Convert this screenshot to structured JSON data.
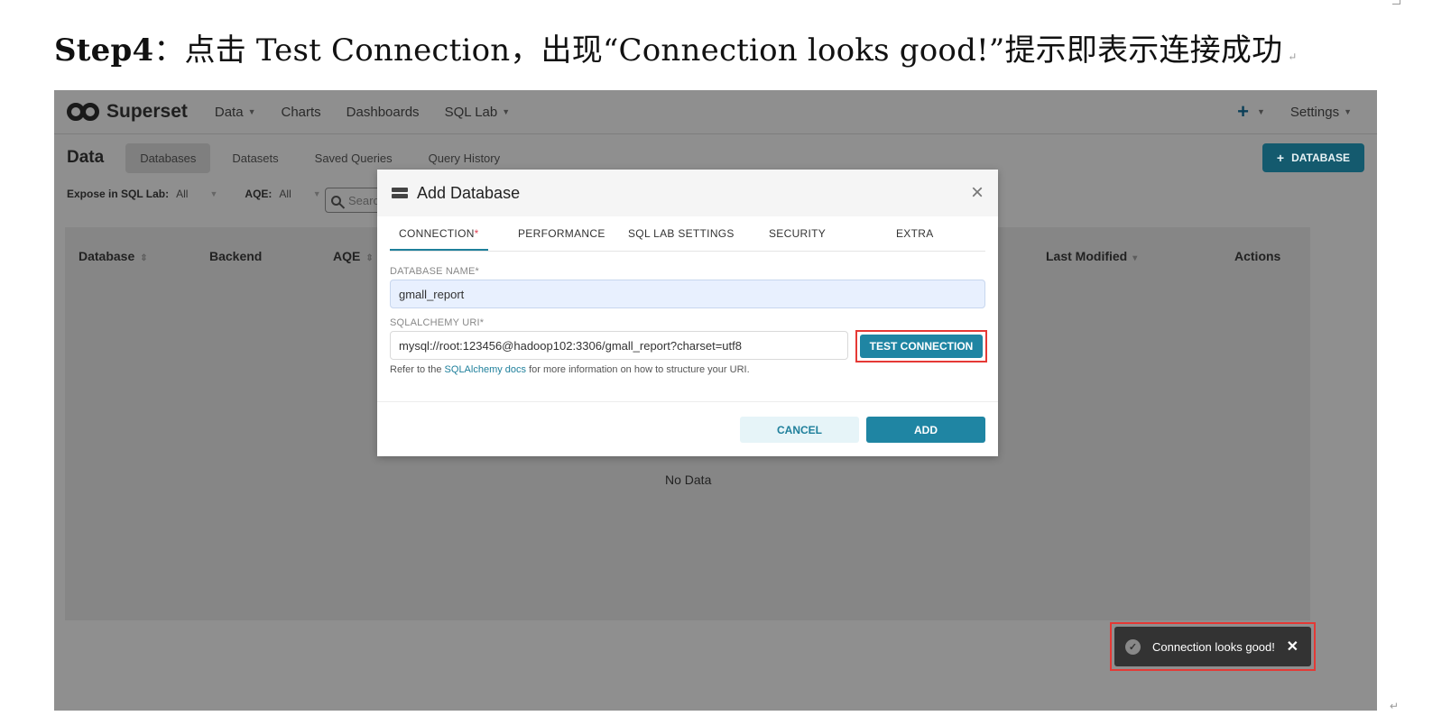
{
  "doc": {
    "step": "Step4",
    "instruction": "：点击 Test Connection，出现“Connection looks good!”提示即表示连接成功",
    "para_mark": "↵"
  },
  "navbar": {
    "brand": "Superset",
    "items": [
      {
        "label": "Data",
        "dropdown": true
      },
      {
        "label": "Charts",
        "dropdown": false
      },
      {
        "label": "Dashboards",
        "dropdown": false
      },
      {
        "label": "SQL Lab",
        "dropdown": true
      }
    ],
    "plus": "+",
    "settings": "Settings"
  },
  "subnav": {
    "title": "Data",
    "tabs": [
      "Databases",
      "Datasets",
      "Saved Queries",
      "Query History"
    ],
    "active_tab": "Databases",
    "add_db_button": "DATABASE",
    "add_db_plus": "+"
  },
  "filters": {
    "expose_label": "Expose in SQL Lab:",
    "expose_value": "All",
    "aqe_label": "AQE:",
    "aqe_value": "All",
    "search_placeholder": "Searc"
  },
  "table": {
    "columns": [
      "Database",
      "Backend",
      "AQE",
      "Last Modified",
      "Actions"
    ],
    "empty_text": "No Data"
  },
  "modal": {
    "title": "Add Database",
    "close": "×",
    "tabs": [
      "CONNECTION",
      "PERFORMANCE",
      "SQL LAB SETTINGS",
      "SECURITY",
      "EXTRA"
    ],
    "required_mark": "*",
    "db_name_label": "DATABASE NAME*",
    "db_name_value": "gmall_report",
    "uri_label": "SQLALCHEMY URI*",
    "uri_value": "mysql://root:123456@hadoop102:3306/gmall_report?charset=utf8",
    "test_button": "TEST CONNECTION",
    "help_prefix": "Refer to the ",
    "help_link": "SQLAlchemy docs",
    "help_suffix": " for more information on how to structure your URI.",
    "cancel_button": "CANCEL",
    "add_button": "ADD"
  },
  "toast": {
    "message": "Connection looks good!",
    "close": "✕"
  },
  "colors": {
    "accent": "#1f85a3",
    "highlight_border": "#e53935",
    "overlay": "#8f8f8f"
  }
}
